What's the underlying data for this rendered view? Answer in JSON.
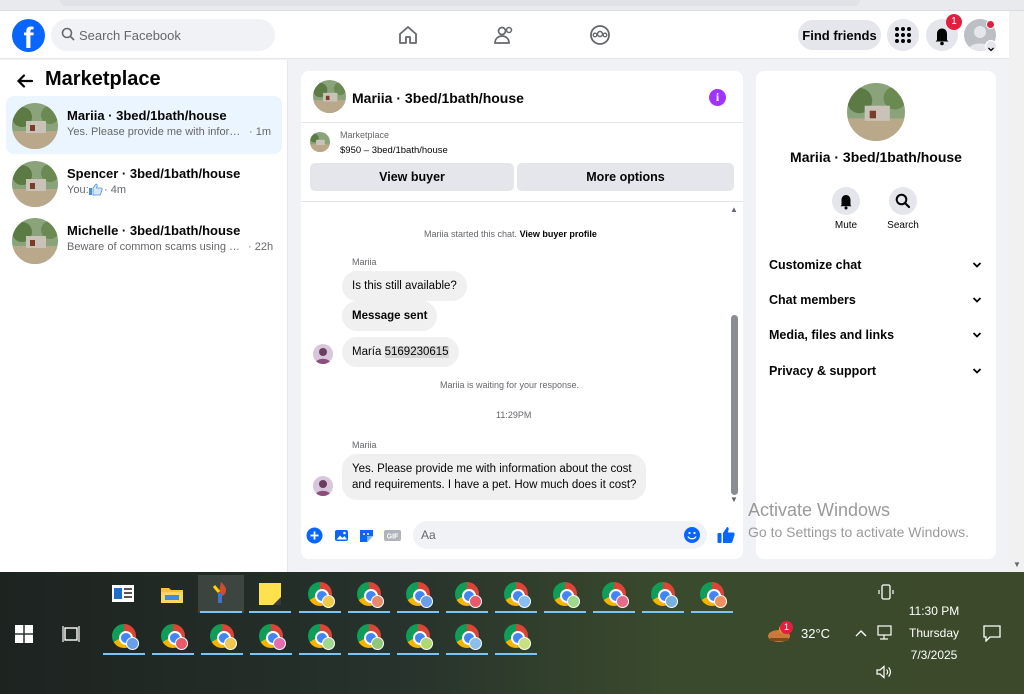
{
  "topbar": {
    "search_placeholder": "Search Facebook",
    "find_friends_label": "Find friends",
    "notification_count": "1"
  },
  "sidebar": {
    "title": "Marketplace",
    "conversations": [
      {
        "name": "Mariia · 3bed/1bath/house",
        "snippet": "Yes. Please provide me with informati...",
        "time": "· 1m",
        "active": true
      },
      {
        "name": "Spencer · 3bed/1bath/house",
        "snippet": "You:",
        "time": "· 4m",
        "active": false
      },
      {
        "name": "Michelle · 3bed/1bath/house",
        "snippet": "Beware of common scams using pay...",
        "time": "· 22h",
        "active": false
      }
    ]
  },
  "chat": {
    "title": "Mariia · 3bed/1bath/house",
    "listing_source": "Marketplace",
    "listing_price": "$950 – 3bed/1bath/house",
    "view_buyer_label": "View buyer",
    "more_options_label": "More options",
    "started_text": "Mariia started this chat.",
    "view_buyer_profile": "View buyer profile",
    "sender1": "Mariia",
    "msg1": "Is this still available?",
    "msg2": "Message sent",
    "msg3_name": "María",
    "msg3_phone": "5169230615",
    "waiting_text": "Mariia is waiting for your response.",
    "timestamp": "11:29PM",
    "sender2": "Mariia",
    "msg4_line1": "Yes. Please provide me with information about the cost",
    "msg4_line2": "and requirements. I have a pet. How much does it cost?",
    "composer_placeholder": "Aa"
  },
  "info_panel": {
    "name": "Mariia · 3bed/1bath/house",
    "mute_label": "Mute",
    "search_label": "Search",
    "sections": [
      "Customize chat",
      "Chat members",
      "Media, files and links",
      "Privacy & support"
    ]
  },
  "watermark": {
    "line1": "Activate Windows",
    "line2": "Go to Settings to activate Windows."
  },
  "taskbar": {
    "weather_badge": "1",
    "temperature": "32°C",
    "time": "11:30 PM",
    "day": "Thursday",
    "date": "7/3/2025"
  },
  "colors": {
    "facebook_blue": "#0866ff",
    "active_conversation": "#ebf5ff",
    "info_purple": "#a033ff",
    "badge_red": "#e41e3f"
  }
}
